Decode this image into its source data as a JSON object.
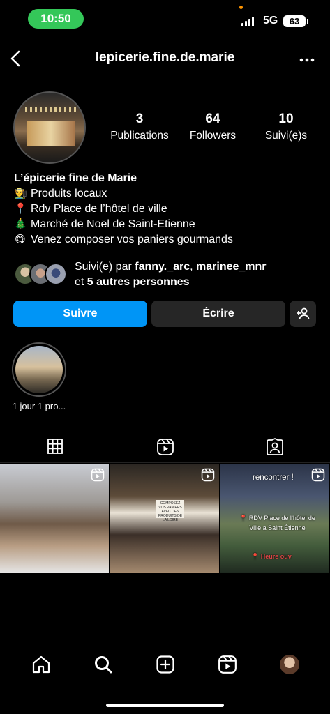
{
  "status": {
    "time": "10:50",
    "network": "5G",
    "battery": "63"
  },
  "nav": {
    "username": "lepicerie.fine.de.marie"
  },
  "stats": [
    {
      "value": "3",
      "label": "Publications"
    },
    {
      "value": "64",
      "label": "Followers"
    },
    {
      "value": "10",
      "label": "Suivi(e)s"
    }
  ],
  "bio": {
    "name": "L’épicerie fine de Marie",
    "lines": [
      {
        "icon": "farmer-emoji",
        "glyph": "👨‍🌾",
        "text": "Produits locaux"
      },
      {
        "icon": "pin-emoji",
        "glyph": "📍",
        "text": "Rdv Place de l’hôtel de ville"
      },
      {
        "icon": "christmas-tree-emoji",
        "glyph": "🎄",
        "text": "Marché de Noël de Saint-Etienne"
      },
      {
        "icon": "yum-emoji",
        "glyph": "😋",
        "text": "Venez composer vos paniers gourmands"
      }
    ]
  },
  "mutuals": {
    "prefix": "Suivi(e) par",
    "user1": "fanny._arc",
    "sep": ",",
    "user2": "marinee_mnr",
    "and": "et",
    "others": "5 autres personnes"
  },
  "actions": {
    "follow": "Suivre",
    "message": "Écrire"
  },
  "highlight": {
    "label": "1 jour 1 pro..."
  },
  "posts": [
    {
      "type": "reel"
    },
    {
      "type": "reel",
      "sign": "COMPOSEZ VOS PANIERS AVEC DES PRODUITS DE LA LOIRE"
    },
    {
      "type": "reel",
      "top": "rencontrer !",
      "middle": "📍 RDV Place de l’hôtel de Ville a Saint Étienne",
      "bottom": "📍 Heure ouv"
    }
  ],
  "colors": {
    "accent": "#0095f6",
    "pill": "#34c759",
    "button_dark": "#262626"
  }
}
